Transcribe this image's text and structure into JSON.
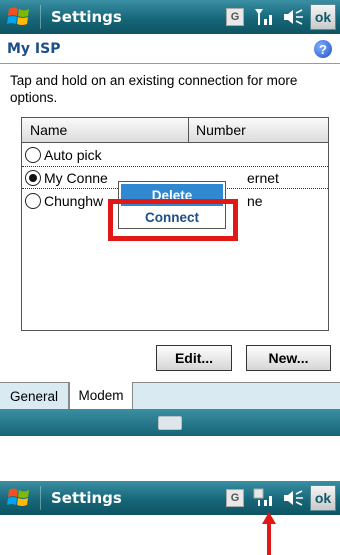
{
  "titlebar": {
    "title": "Settings",
    "status_g": "G",
    "ok_label": "ok"
  },
  "header": {
    "title": "My ISP",
    "help": "?"
  },
  "instructions": "Tap and hold on an existing connection for more options.",
  "list": {
    "columns": [
      "Name",
      "Number"
    ],
    "rows": [
      {
        "name": "Auto pick",
        "number": "",
        "selected": false
      },
      {
        "name": "My Conne",
        "number": "ernet",
        "selected": true
      },
      {
        "name": "Chunghw",
        "number": "ne",
        "selected": false
      }
    ]
  },
  "context_menu": {
    "items": [
      "Delete",
      "Connect"
    ]
  },
  "buttons": {
    "edit": "Edit...",
    "new": "New..."
  },
  "tabs": [
    "General",
    "Modem"
  ],
  "bottom_titlebar": {
    "title": "Settings",
    "status_g": "G",
    "ok_label": "ok"
  },
  "colors": {
    "titlebar": "#166779",
    "highlight": "#e21818",
    "menu_selected": "#2f88d0"
  }
}
